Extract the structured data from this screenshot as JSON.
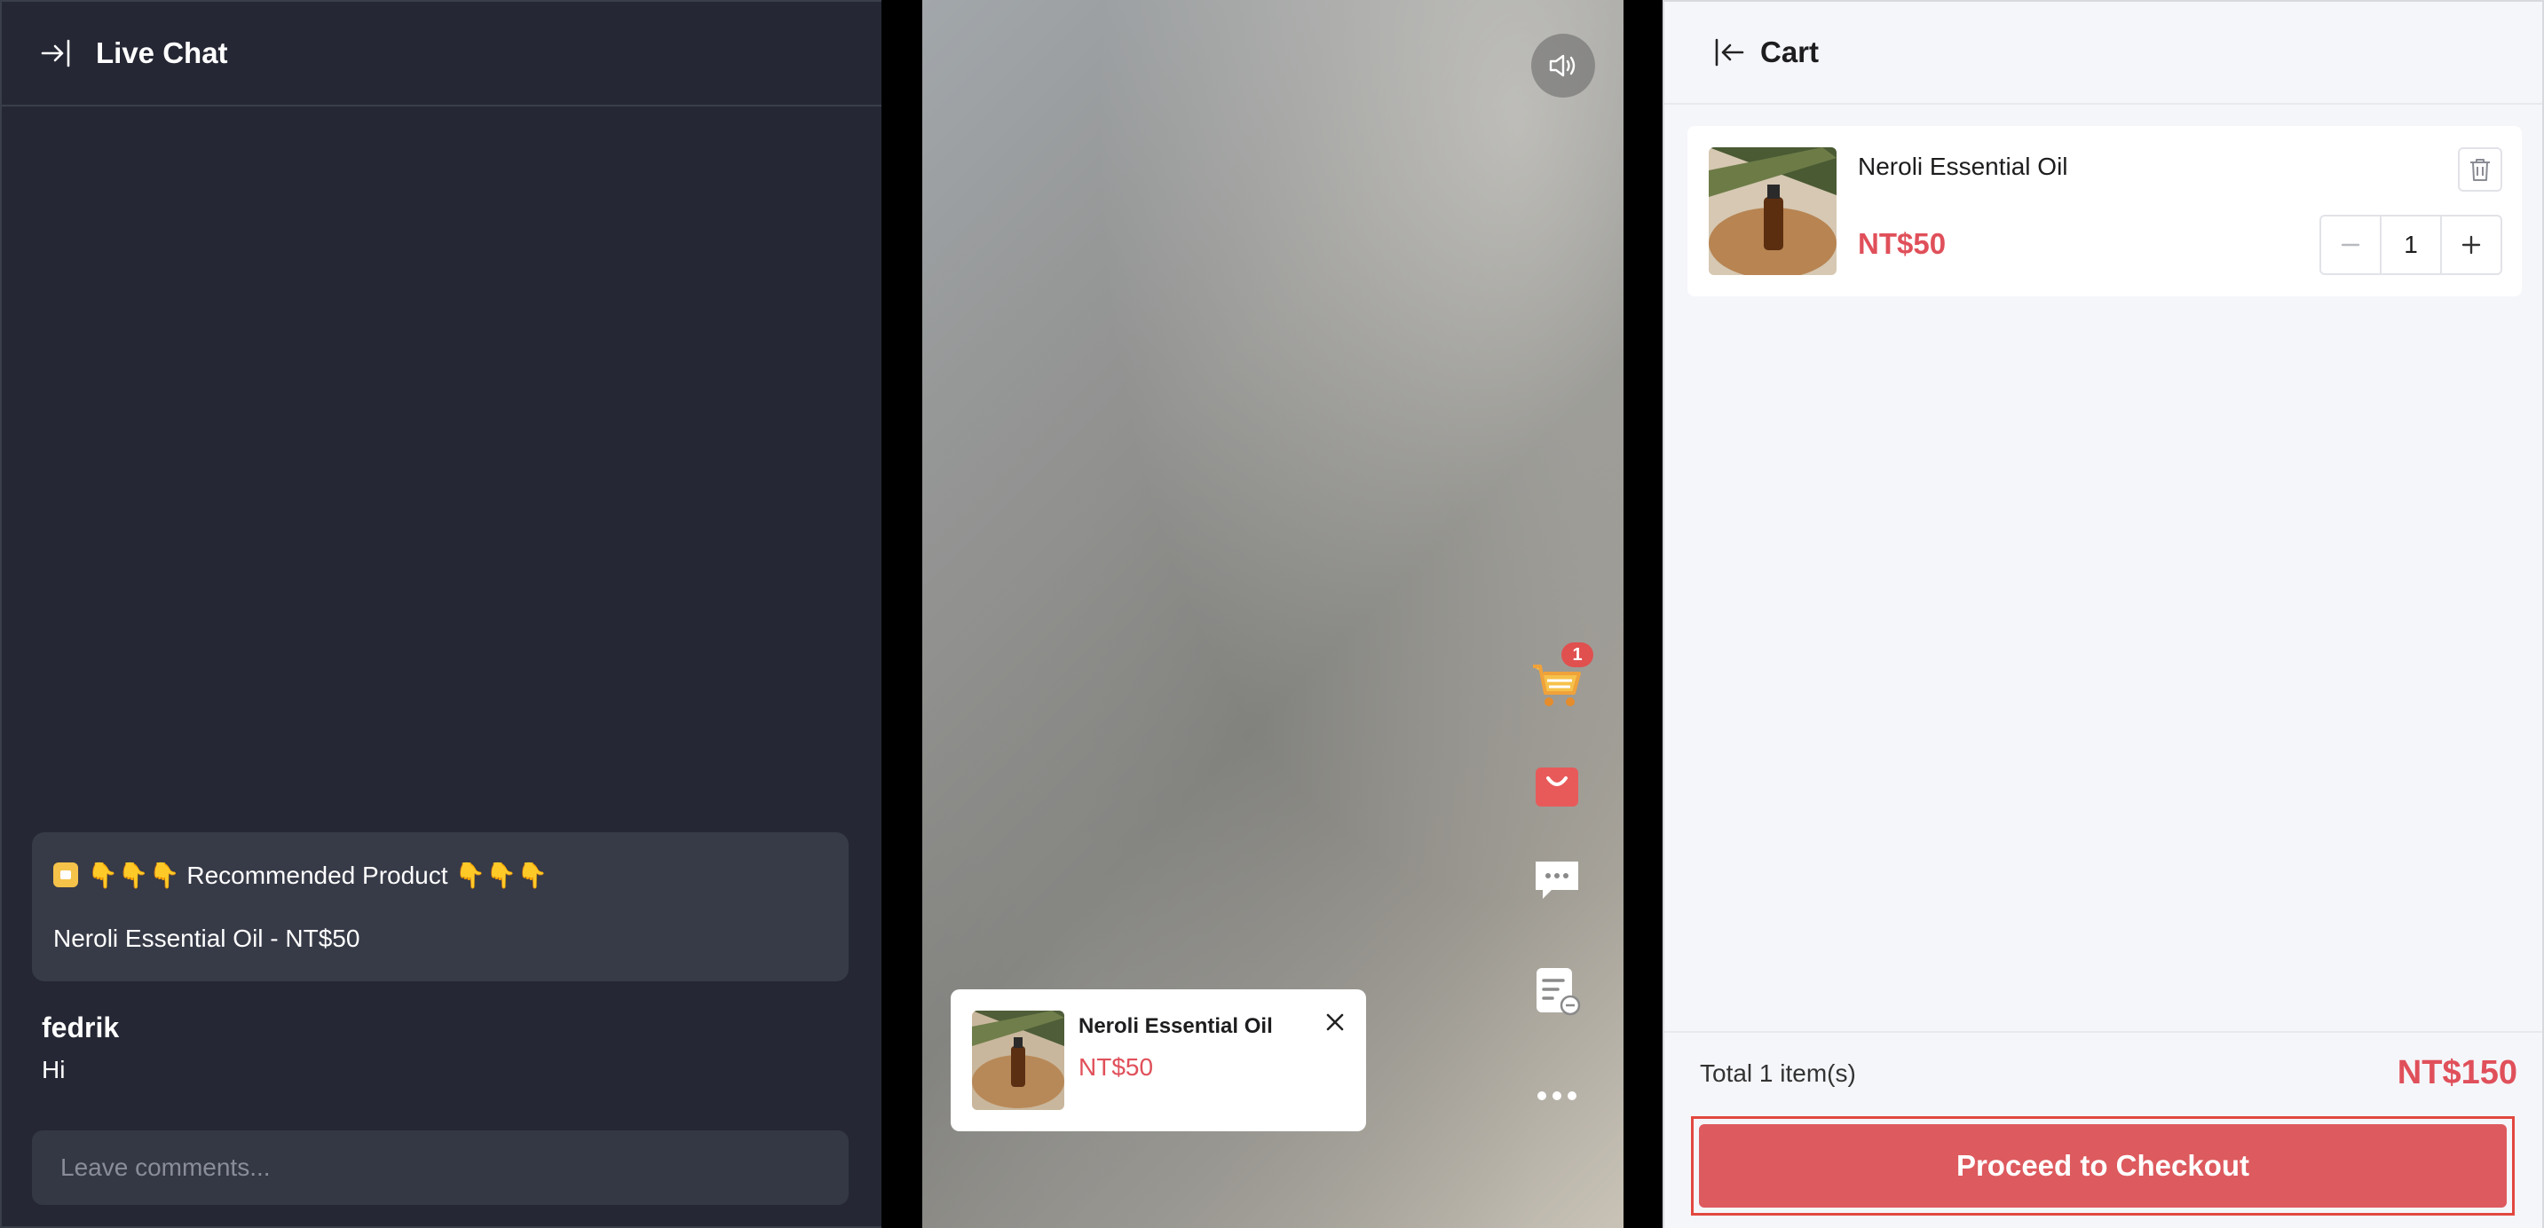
{
  "chat": {
    "title": "Live Chat",
    "recommended": {
      "line1": "👇👇👇 Recommended Product 👇👇👇",
      "line2": "Neroli Essential Oil - NT$50"
    },
    "messages": [
      {
        "user": "fedrik",
        "text": "Hi"
      }
    ],
    "input_placeholder": "Leave comments..."
  },
  "video": {
    "cart_count": "1",
    "product_popup": {
      "name": "Neroli Essential Oil",
      "price": "NT$50"
    }
  },
  "cart": {
    "title": "Cart",
    "items": [
      {
        "name": "Neroli Essential Oil",
        "price": "NT$50",
        "quantity": "1"
      }
    ],
    "total_label": "Total 1 item(s)",
    "total_value": "NT$150",
    "checkout_label": "Proceed to Checkout"
  },
  "colors": {
    "accent": "#e0505a",
    "chat_bg": "#252734",
    "cart_bg": "#f5f6fa"
  }
}
